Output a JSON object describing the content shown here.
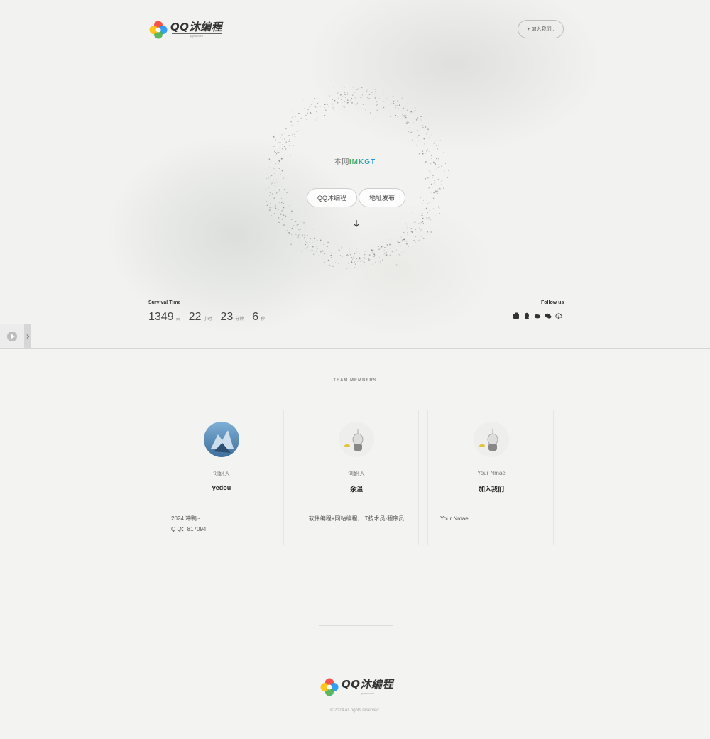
{
  "header": {
    "logo_text": "QQ沐编程",
    "logo_sub": "qqmu.com",
    "join_label": "+ 加入我们.."
  },
  "hero": {
    "slogan_prefix": "本网",
    "slogan_highlight": "IMKGT",
    "buttons": [
      "QQ沐编程",
      "地址发布"
    ]
  },
  "survival": {
    "label": "Survival Time",
    "days": "1349",
    "days_unit": "天",
    "hours": "22",
    "hours_unit": "小时",
    "minutes": "23",
    "minutes_unit": "分钟",
    "seconds": "6",
    "seconds_unit": "秒"
  },
  "follow": {
    "label": "Follow us",
    "icons": [
      "weibo-icon",
      "qq-icon",
      "cloud-icon",
      "wechat-icon",
      "cloud-download-icon"
    ]
  },
  "team": {
    "title": "TEAM MEMBERS",
    "members": [
      {
        "role": "创始人",
        "name": "yedou",
        "desc_lines": [
          "2024 冲鸭~",
          "Q Q：817094"
        ]
      },
      {
        "role": "创始人",
        "name": "余温",
        "desc_lines": [
          "软件编程+网站编程，IT技术员-程序员"
        ]
      },
      {
        "role": "Your Nmae",
        "name": "加入我们",
        "desc_lines": [
          "Your Nmae"
        ]
      }
    ]
  },
  "footer": {
    "logo_text": "QQ沐编程",
    "logo_sub": "qqmu.com",
    "copyright": "© 2024 All rights reserved."
  },
  "colors": {
    "slogan_gradient": [
      "#4caf50",
      "#2196f3"
    ],
    "accent": "#444444"
  }
}
